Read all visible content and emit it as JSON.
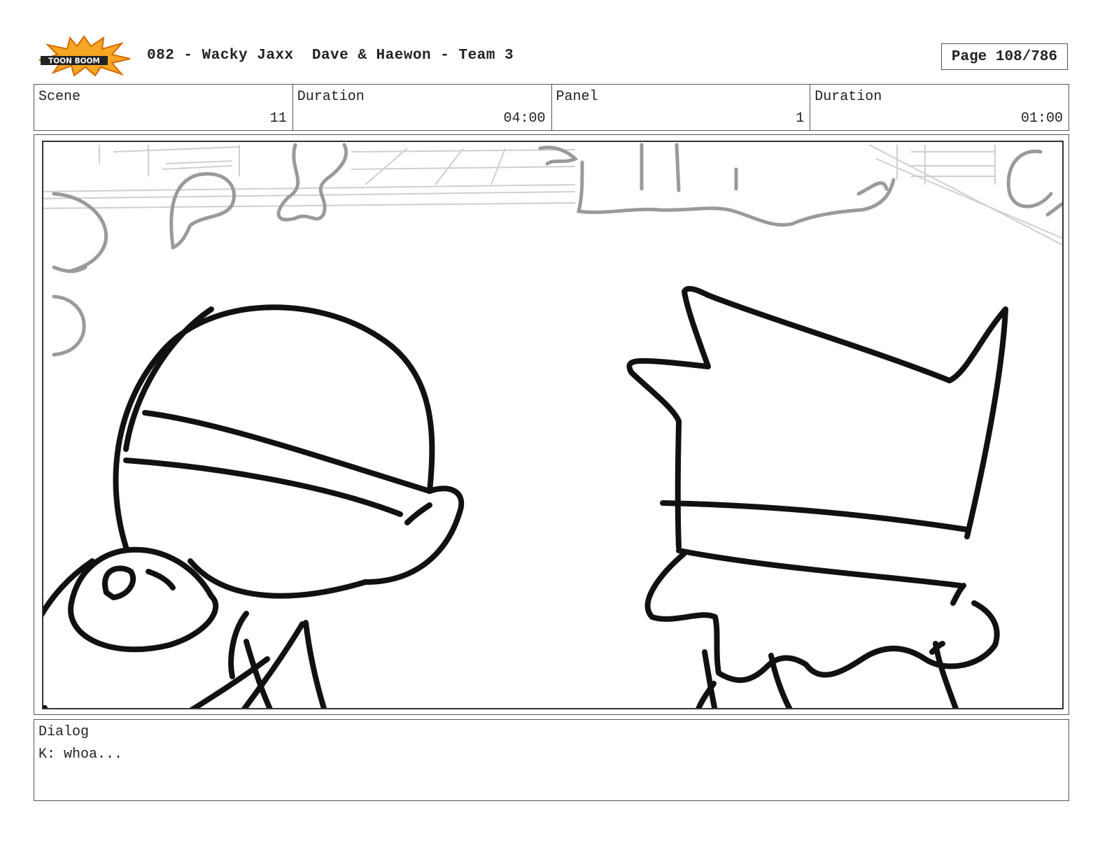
{
  "header": {
    "logo_text": "TOON BOOM",
    "title": "082 - Wacky Jaxx  Dave & Haewon - Team 3",
    "page": "Page 108/786"
  },
  "info": {
    "scene_label": "Scene",
    "scene_value": "11",
    "scene_duration_label": "Duration",
    "scene_duration_value": "04:00",
    "panel_label": "Panel",
    "panel_value": "1",
    "panel_duration_label": "Duration",
    "panel_duration_value": "01:00"
  },
  "dialog": {
    "label": "Dialog",
    "text": "K: whoa..."
  },
  "colors": {
    "logo_burst": "#f5a623",
    "ink": "#111111",
    "background_sketch": "#9a9a9a"
  }
}
